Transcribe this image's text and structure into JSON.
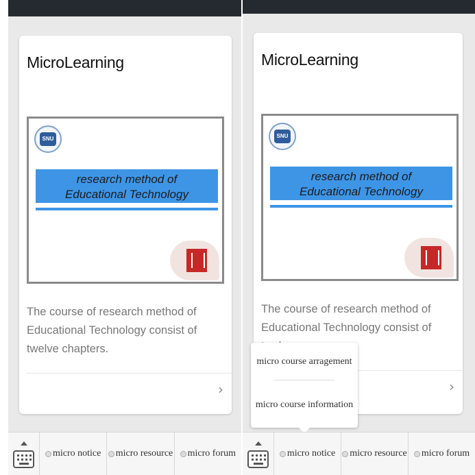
{
  "screens": [
    {
      "card": {
        "title": "MicroLearning",
        "slide": {
          "logo_text": "SNU",
          "banner_line1": "research method of",
          "banner_line2": "Educational Technology"
        },
        "description": "The course of research method of Educational Technology consist of twelve chapters.",
        "chevron": "›"
      },
      "tabbar": {
        "tabs": [
          {
            "label": "micro notice"
          },
          {
            "label": "micro resource"
          },
          {
            "label": "micro forum"
          }
        ]
      }
    },
    {
      "card": {
        "title": "MicroLearning",
        "slide": {
          "logo_text": "SNU",
          "banner_line1": "research method of",
          "banner_line2": "Educational Technology"
        },
        "description": "The course of research method of Educational Technology consist of twelve",
        "chevron": "›"
      },
      "popup": {
        "items": [
          {
            "label": "micro course arragement"
          },
          {
            "label": "micro course information"
          }
        ]
      },
      "tabbar": {
        "tabs": [
          {
            "label": "micro notice"
          },
          {
            "label": "micro resource"
          },
          {
            "label": "micro forum"
          }
        ]
      }
    }
  ]
}
